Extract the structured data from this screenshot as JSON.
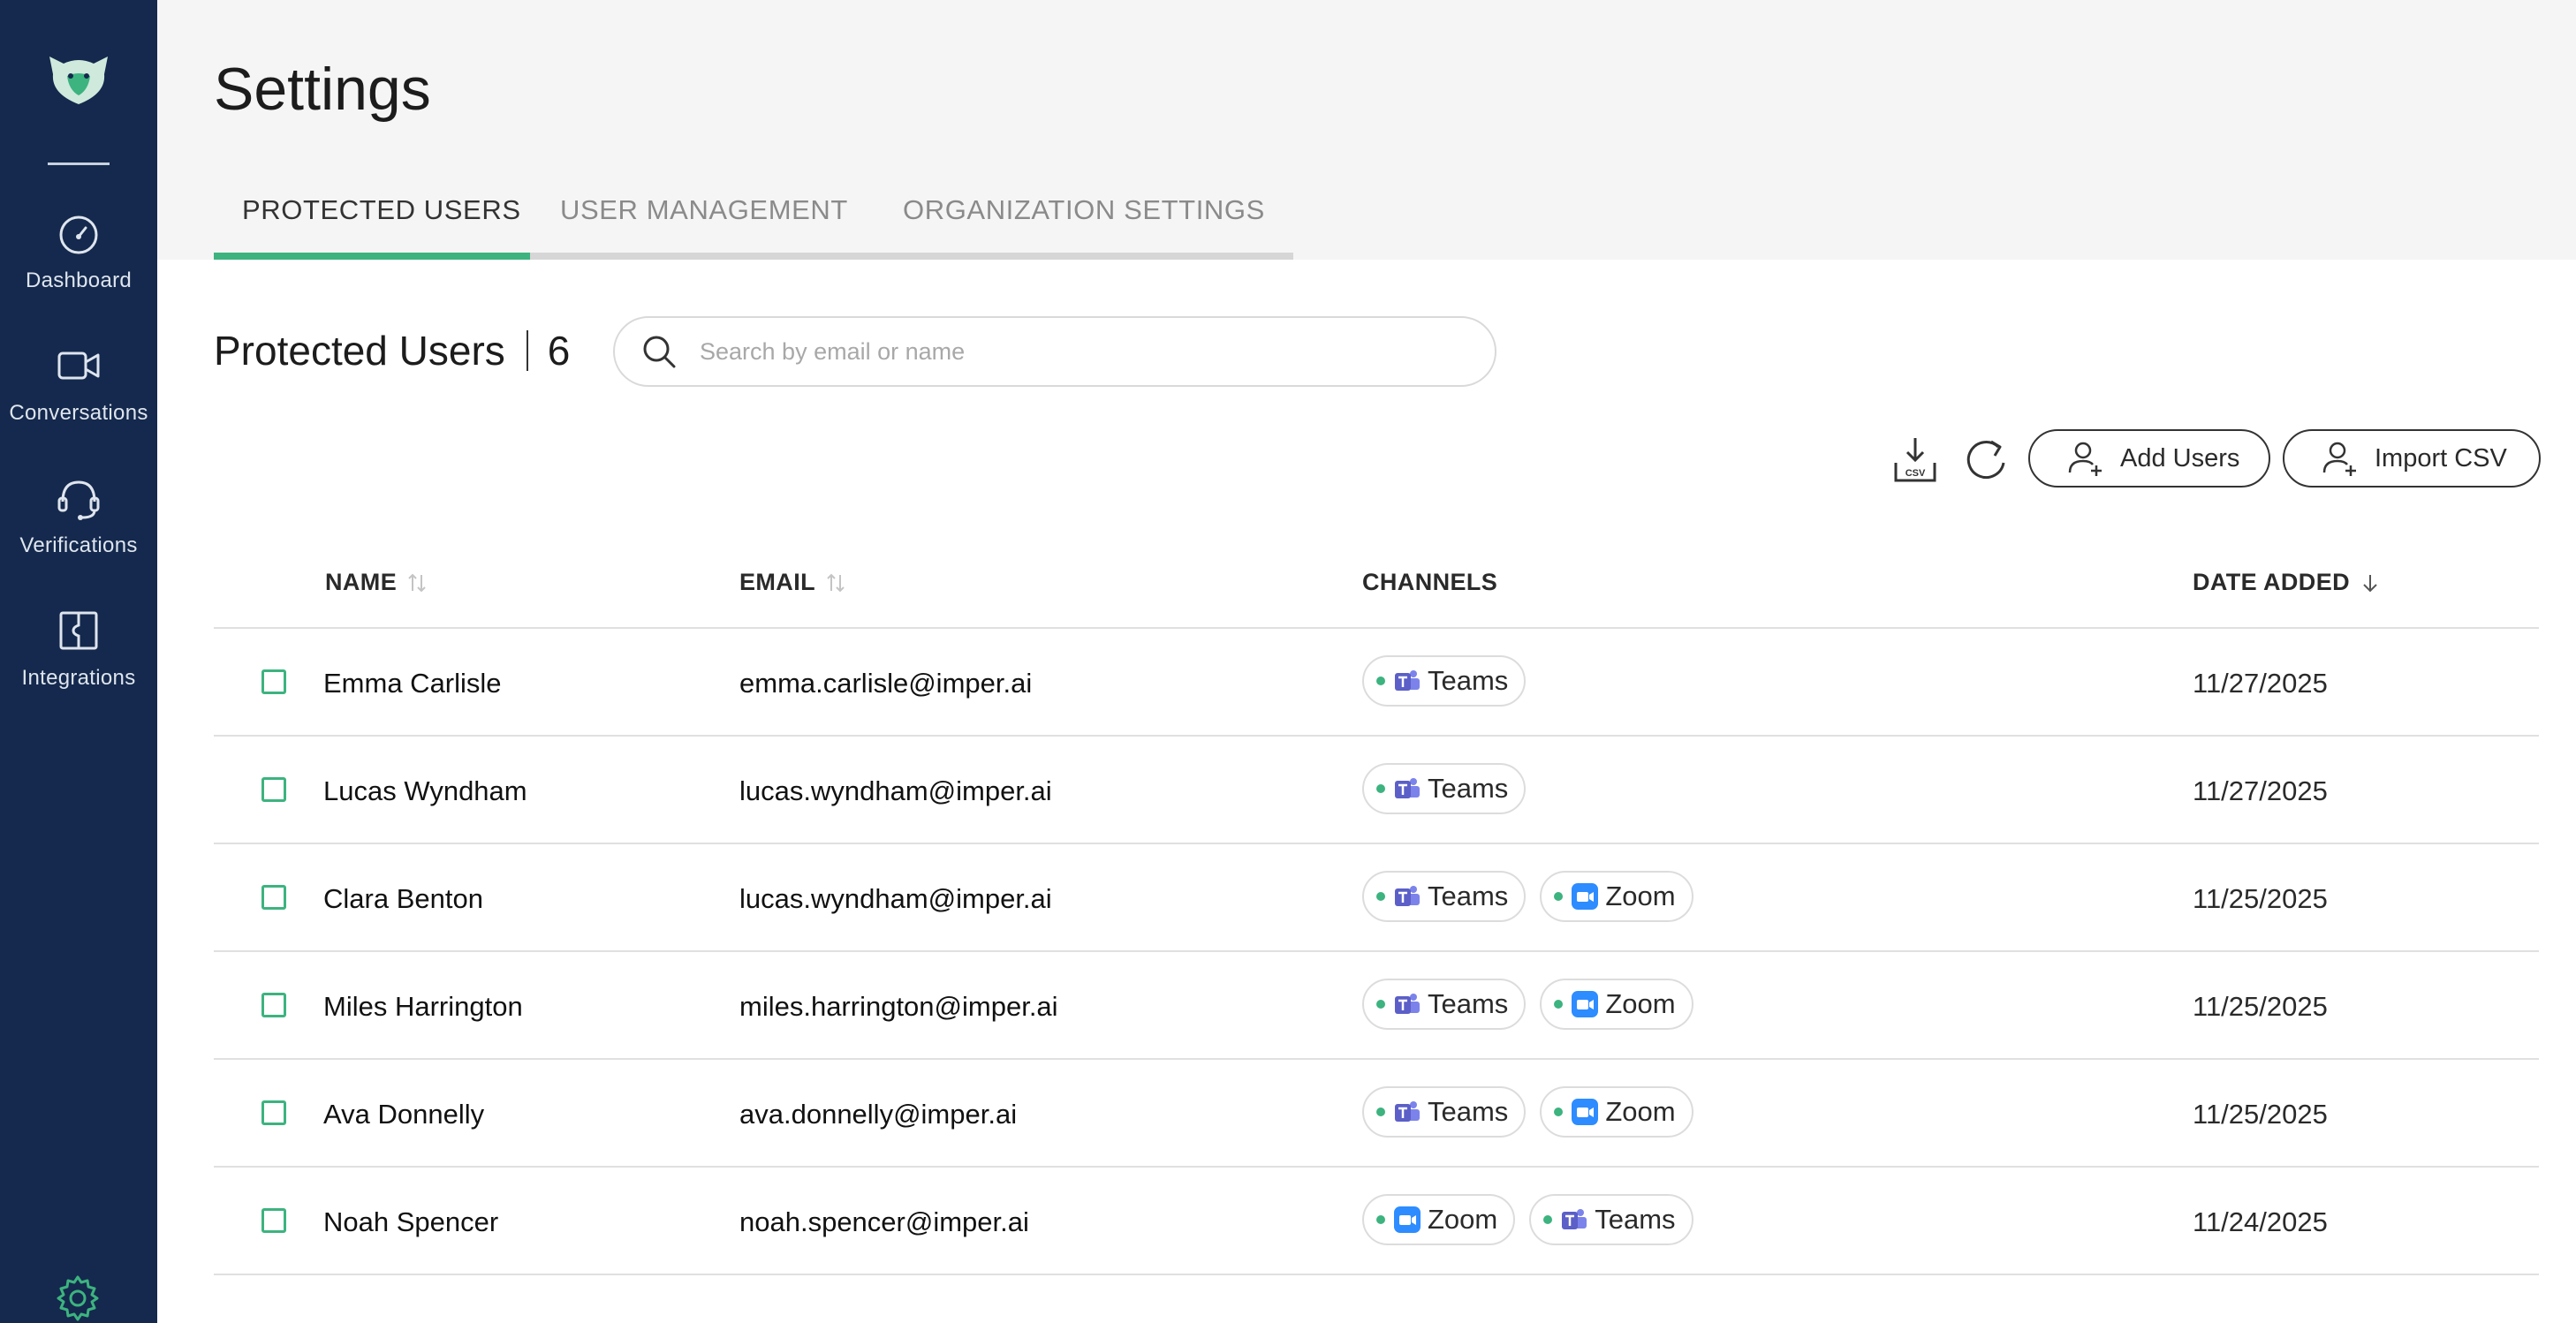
{
  "sidebar": {
    "items": [
      {
        "label": "Dashboard",
        "icon": "speedometer-icon"
      },
      {
        "label": "Conversations",
        "icon": "video-camera-icon"
      },
      {
        "label": "Verifications",
        "icon": "headset-icon"
      },
      {
        "label": "Integrations",
        "icon": "puzzle-icon"
      }
    ],
    "footer_icon": "gear-icon"
  },
  "header": {
    "title": "Settings",
    "tabs": [
      {
        "label": "PROTECTED USERS",
        "active": true
      },
      {
        "label": "USER MANAGEMENT",
        "active": false
      },
      {
        "label": "ORGANIZATION SETTINGS",
        "active": false
      }
    ]
  },
  "content": {
    "section_title": "Protected Users",
    "count": "6",
    "search": {
      "placeholder": "Search by email or name",
      "value": ""
    },
    "actions": {
      "csv_icon_label": "CSV",
      "add_users": "Add Users",
      "import_csv": "Import CSV"
    }
  },
  "table": {
    "columns": {
      "name": "NAME",
      "email": "EMAIL",
      "channels": "CHANNELS",
      "date": "DATE ADDED"
    },
    "rows": [
      {
        "name": "Emma Carlisle",
        "email": "emma.carlisle@imper.ai",
        "channels": [
          "Teams"
        ],
        "date": "11/27/2025"
      },
      {
        "name": "Lucas Wyndham",
        "email": "lucas.wyndham@imper.ai",
        "channels": [
          "Teams"
        ],
        "date": "11/27/2025"
      },
      {
        "name": "Clara Benton",
        "email": "lucas.wyndham@imper.ai",
        "channels": [
          "Teams",
          "Zoom"
        ],
        "date": "11/25/2025"
      },
      {
        "name": "Miles Harrington",
        "email": "miles.harrington@imper.ai",
        "channels": [
          "Teams",
          "Zoom"
        ],
        "date": "11/25/2025"
      },
      {
        "name": "Ava Donnelly",
        "email": "ava.donnelly@imper.ai",
        "channels": [
          "Teams",
          "Zoom"
        ],
        "date": "11/25/2025"
      },
      {
        "name": "Noah Spencer",
        "email": "noah.spencer@imper.ai",
        "channels": [
          "Zoom",
          "Teams"
        ],
        "date": "11/24/2025"
      }
    ]
  },
  "colors": {
    "sidebar_bg": "#14294d",
    "accent_green": "#3db37f",
    "teams_purple": "#5b5fc7",
    "zoom_blue": "#2d8cff"
  }
}
